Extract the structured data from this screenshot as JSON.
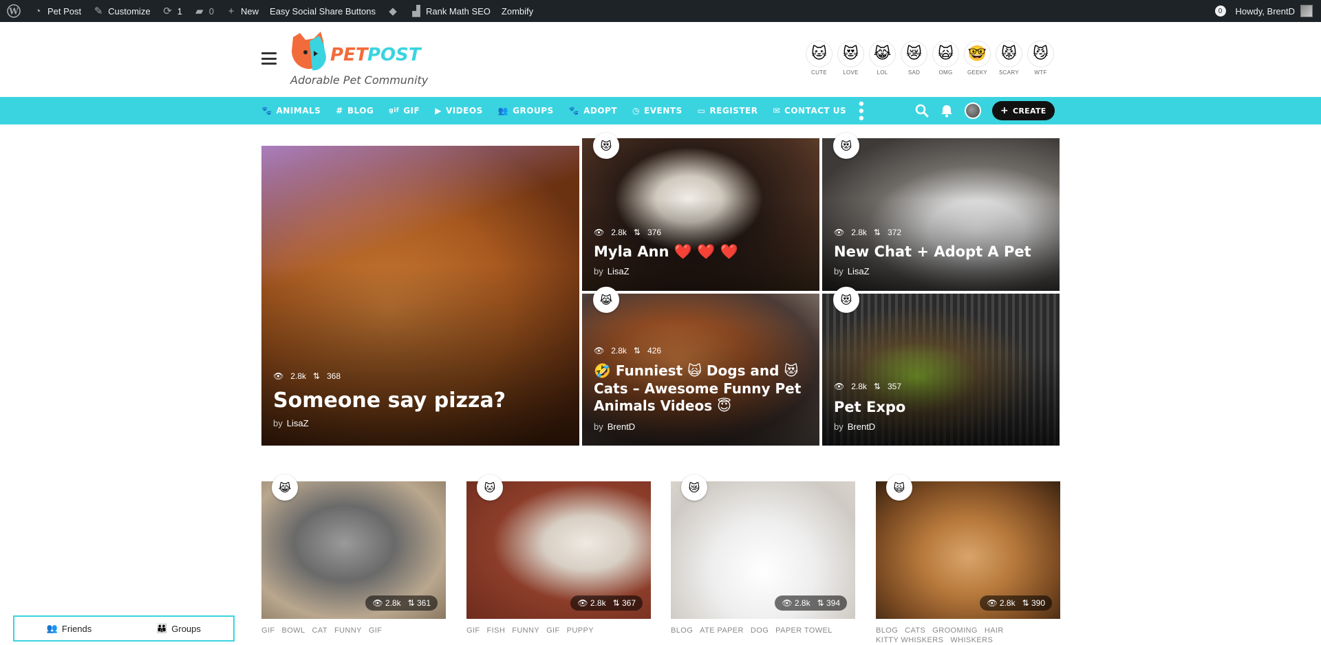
{
  "adminbar": {
    "site_name": "Pet Post",
    "customize": "Customize",
    "updates_count": "1",
    "comments_count": "0",
    "new": "New",
    "social": "Easy Social Share Buttons",
    "rankmath": "Rank Math SEO",
    "zombify": "Zombify",
    "notif_count": "0",
    "howdy": "Howdy, BrentD"
  },
  "header": {
    "tagline": "Adorable Pet Community",
    "reactions": [
      {
        "label": "CUTE",
        "icon": "cute-cat-icon"
      },
      {
        "label": "LOVE",
        "icon": "love-cat-icon"
      },
      {
        "label": "LOL",
        "icon": "lol-cat-icon"
      },
      {
        "label": "SAD",
        "icon": "sad-cat-icon"
      },
      {
        "label": "OMG",
        "icon": "omg-cat-icon"
      },
      {
        "label": "GEEKY",
        "icon": "geeky-cat-icon"
      },
      {
        "label": "SCARY",
        "icon": "scary-cat-icon"
      },
      {
        "label": "WTF",
        "icon": "wtf-cat-icon"
      }
    ]
  },
  "nav": {
    "items": [
      {
        "label": "ANIMALS",
        "icon": "paw-icon"
      },
      {
        "label": "BLOG",
        "icon": "hashtag-icon"
      },
      {
        "label": "GIF",
        "icon": "gif-icon"
      },
      {
        "label": "VIDEOS",
        "icon": "video-camera-icon"
      },
      {
        "label": "GROUPS",
        "icon": "users-icon"
      },
      {
        "label": "ADOPT",
        "icon": "paw-icon"
      },
      {
        "label": "EVENTS",
        "icon": "clock-icon"
      },
      {
        "label": "REGISTER",
        "icon": "id-card-icon"
      },
      {
        "label": "CONTACT US",
        "icon": "envelope-icon"
      }
    ],
    "create_label": "CREATE",
    "accent": "#3ad4e0"
  },
  "featured": [
    {
      "title": "Someone say pizza?",
      "views": "2.8k",
      "shares": "368",
      "author": "LisaZ"
    },
    {
      "title": "Myla Ann ❤️ ❤️ ❤️",
      "views": "2.8k",
      "shares": "376",
      "author": "LisaZ"
    },
    {
      "title": "New Chat + Adopt A Pet",
      "views": "2.8k",
      "shares": "372",
      "author": "LisaZ"
    },
    {
      "title": "🤣 Funniest 🙀 Dogs and 😻 Cats – Awesome Funny Pet Animals Videos 😇",
      "views": "2.8k",
      "shares": "426",
      "author": "BrentD"
    },
    {
      "title": "Pet Expo",
      "views": "2.8k",
      "shares": "357",
      "author": "BrentD"
    }
  ],
  "by_label": "by",
  "grid": [
    {
      "views": "2.8k",
      "shares": "361",
      "tags": [
        "GIF",
        "BOWL",
        "CAT",
        "FUNNY",
        "GIF"
      ]
    },
    {
      "views": "2.8k",
      "shares": "367",
      "tags": [
        "GIF",
        "FISH",
        "FUNNY",
        "GIF",
        "PUPPY"
      ]
    },
    {
      "views": "2.8k",
      "shares": "394",
      "tags": [
        "BLOG",
        "ATE PAPER",
        "DOG",
        "PAPER TOWEL"
      ]
    },
    {
      "views": "2.8k",
      "shares": "390",
      "tags": [
        "BLOG",
        "CATS",
        "GROOMING",
        "HAIR",
        "KITTY WHISKERS",
        "WHISKERS"
      ]
    }
  ],
  "bottom_tabs": {
    "friends": "Friends",
    "groups": "Groups"
  }
}
